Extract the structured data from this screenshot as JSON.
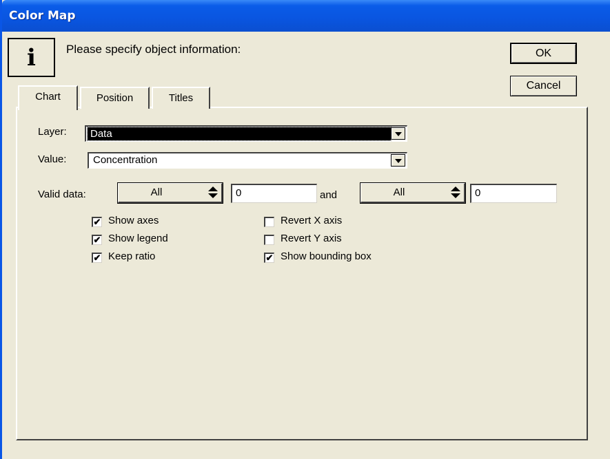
{
  "window": {
    "title": "Color Map"
  },
  "header": {
    "icon": "info-icon",
    "icon_glyph": "i",
    "prompt": "Please specify object information:"
  },
  "buttons": {
    "ok": "OK",
    "cancel": "Cancel"
  },
  "tabs": [
    {
      "label": "Chart",
      "selected": true
    },
    {
      "label": "Position",
      "selected": false
    },
    {
      "label": "Titles",
      "selected": false
    }
  ],
  "chart": {
    "layer_label": "Layer:",
    "layer_value": "Data",
    "value_label": "Value:",
    "value_value": "Concentration",
    "valid_label": "Valid data:",
    "valid_from_mode": "All",
    "valid_from_value": "0",
    "and_label": "and",
    "valid_to_mode": "All",
    "valid_to_value": "0",
    "checkboxes": [
      {
        "label": "Show axes",
        "checked": true
      },
      {
        "label": "Show legend",
        "checked": true
      },
      {
        "label": "Keep ratio",
        "checked": true
      },
      {
        "label": "Revert X axis",
        "checked": false
      },
      {
        "label": "Revert Y axis",
        "checked": false
      },
      {
        "label": "Show bounding box",
        "checked": true
      }
    ]
  },
  "colors": {
    "title_bar": "#0a55e0",
    "face": "#ece9d8"
  }
}
